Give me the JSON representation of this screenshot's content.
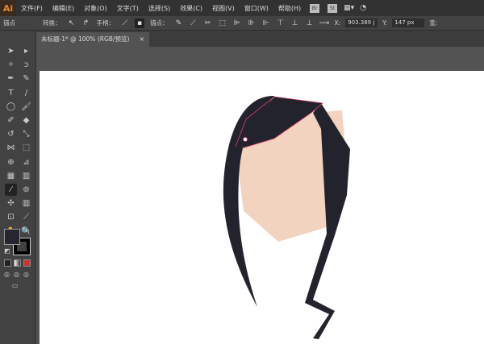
{
  "app": {
    "logo": "Ai"
  },
  "menus": [
    "文件(F)",
    "编辑(E)",
    "对象(O)",
    "文字(T)",
    "选择(S)",
    "效果(C)",
    "视图(V)",
    "窗口(W)",
    "帮助(H)"
  ],
  "app_buttons": [
    "Br",
    "St"
  ],
  "control": {
    "anchor_label": "锚点",
    "convert_label": "转换：",
    "handles_label": "手柄：",
    "anchors_label": "锚点：",
    "x_label": "X:",
    "x_value": "903.389 j",
    "y_label": "Y:",
    "y_value": "147 px",
    "w_label": "宽:"
  },
  "document_tab": {
    "title": "未标题-1* @ 100% (RGB/预览)",
    "close": "×"
  },
  "tools": [
    "selection",
    "direct-selection",
    "magic-wand",
    "lasso",
    "pen",
    "pencil",
    "type",
    "line",
    "ellipse",
    "paintbrush",
    "shaper",
    "eraser",
    "rotate",
    "scale",
    "width",
    "free-transform",
    "shape-builder",
    "perspective",
    "mesh",
    "gradient",
    "eyedropper",
    "blend",
    "symbol-sprayer",
    "column-graph",
    "artboard",
    "slice",
    "hand",
    "zoom"
  ],
  "active_tool": "eyedropper",
  "colors": {
    "fill": "#262630",
    "hair": "#23232d",
    "skin": "#f2d3bf",
    "path": "#e0416a"
  }
}
